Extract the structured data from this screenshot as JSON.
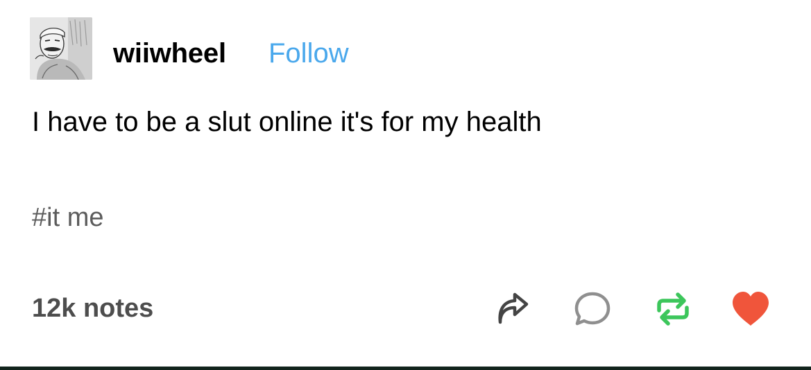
{
  "post": {
    "username": "wiiwheel",
    "follow_label": "Follow",
    "body": "I have to be a slut online it's for my health",
    "tag": "#it me",
    "notes": "12k notes"
  },
  "icons": {
    "avatar": "avatar-image",
    "share": "share-arrow-icon",
    "reply": "reply-bubble-icon",
    "reblog": "reblog-icon",
    "like": "heart-icon"
  },
  "colors": {
    "follow": "#4aa8ec",
    "reblog": "#3cc65b",
    "like": "#f0553b",
    "icon_gray": "#444444"
  }
}
